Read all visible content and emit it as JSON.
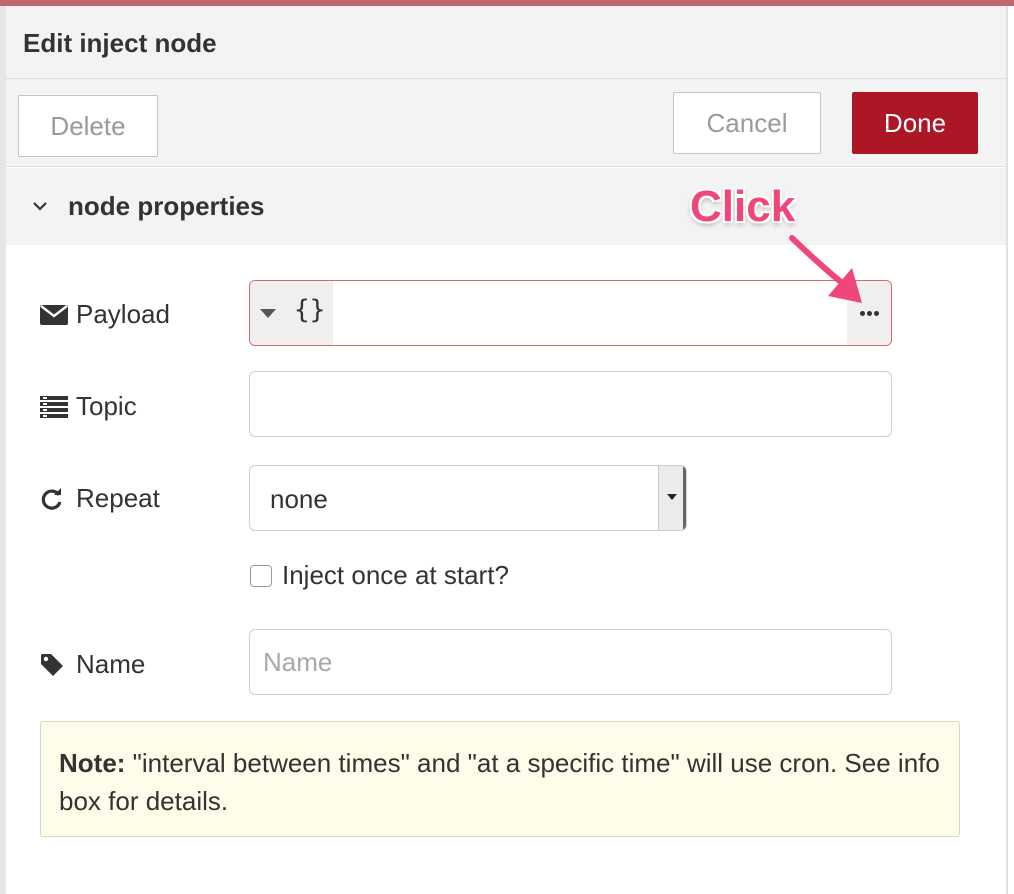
{
  "header": {
    "title": "Edit inject node"
  },
  "toolbar": {
    "delete_label": "Delete",
    "cancel_label": "Cancel",
    "done_label": "Done"
  },
  "section": {
    "title": "node properties"
  },
  "form": {
    "payload": {
      "label": "Payload",
      "type_label": "{}",
      "value": ""
    },
    "topic": {
      "label": "Topic",
      "value": ""
    },
    "repeat": {
      "label": "Repeat",
      "value": "none"
    },
    "inject_once": {
      "label": "Inject once at start?",
      "checked": false
    },
    "name": {
      "label": "Name",
      "value": "",
      "placeholder": "Name"
    }
  },
  "note": {
    "bold": "Note:",
    "text": " \"interval between times\" and \"at a specific time\" will use cron. See info box for details."
  },
  "annotation": {
    "text": "Click",
    "color": "#f0477a"
  },
  "colors": {
    "done": "#ad1625",
    "accent": "#c0676e",
    "note_bg": "#fdfde9"
  },
  "icons": [
    "chevron-down-icon",
    "envelope-icon",
    "list-icon",
    "refresh-icon",
    "tag-icon",
    "ellipsis-icon",
    "caret-down-icon"
  ]
}
